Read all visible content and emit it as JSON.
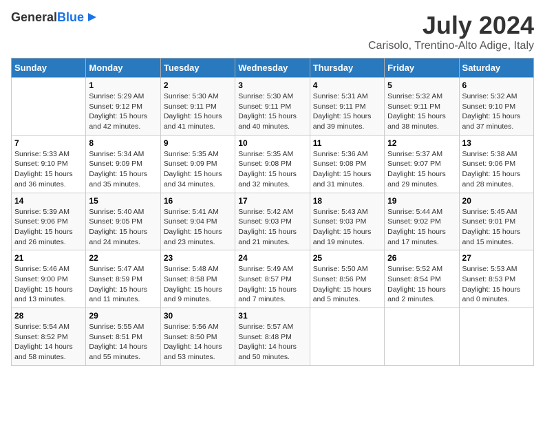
{
  "logo": {
    "line1": "General",
    "line2": "Blue"
  },
  "title": "July 2024",
  "location": "Carisolo, Trentino-Alto Adige, Italy",
  "days_of_week": [
    "Sunday",
    "Monday",
    "Tuesday",
    "Wednesday",
    "Thursday",
    "Friday",
    "Saturday"
  ],
  "weeks": [
    [
      {
        "day": "",
        "info": ""
      },
      {
        "day": "1",
        "info": "Sunrise: 5:29 AM\nSunset: 9:12 PM\nDaylight: 15 hours\nand 42 minutes."
      },
      {
        "day": "2",
        "info": "Sunrise: 5:30 AM\nSunset: 9:11 PM\nDaylight: 15 hours\nand 41 minutes."
      },
      {
        "day": "3",
        "info": "Sunrise: 5:30 AM\nSunset: 9:11 PM\nDaylight: 15 hours\nand 40 minutes."
      },
      {
        "day": "4",
        "info": "Sunrise: 5:31 AM\nSunset: 9:11 PM\nDaylight: 15 hours\nand 39 minutes."
      },
      {
        "day": "5",
        "info": "Sunrise: 5:32 AM\nSunset: 9:11 PM\nDaylight: 15 hours\nand 38 minutes."
      },
      {
        "day": "6",
        "info": "Sunrise: 5:32 AM\nSunset: 9:10 PM\nDaylight: 15 hours\nand 37 minutes."
      }
    ],
    [
      {
        "day": "7",
        "info": "Sunrise: 5:33 AM\nSunset: 9:10 PM\nDaylight: 15 hours\nand 36 minutes."
      },
      {
        "day": "8",
        "info": "Sunrise: 5:34 AM\nSunset: 9:09 PM\nDaylight: 15 hours\nand 35 minutes."
      },
      {
        "day": "9",
        "info": "Sunrise: 5:35 AM\nSunset: 9:09 PM\nDaylight: 15 hours\nand 34 minutes."
      },
      {
        "day": "10",
        "info": "Sunrise: 5:35 AM\nSunset: 9:08 PM\nDaylight: 15 hours\nand 32 minutes."
      },
      {
        "day": "11",
        "info": "Sunrise: 5:36 AM\nSunset: 9:08 PM\nDaylight: 15 hours\nand 31 minutes."
      },
      {
        "day": "12",
        "info": "Sunrise: 5:37 AM\nSunset: 9:07 PM\nDaylight: 15 hours\nand 29 minutes."
      },
      {
        "day": "13",
        "info": "Sunrise: 5:38 AM\nSunset: 9:06 PM\nDaylight: 15 hours\nand 28 minutes."
      }
    ],
    [
      {
        "day": "14",
        "info": "Sunrise: 5:39 AM\nSunset: 9:06 PM\nDaylight: 15 hours\nand 26 minutes."
      },
      {
        "day": "15",
        "info": "Sunrise: 5:40 AM\nSunset: 9:05 PM\nDaylight: 15 hours\nand 24 minutes."
      },
      {
        "day": "16",
        "info": "Sunrise: 5:41 AM\nSunset: 9:04 PM\nDaylight: 15 hours\nand 23 minutes."
      },
      {
        "day": "17",
        "info": "Sunrise: 5:42 AM\nSunset: 9:03 PM\nDaylight: 15 hours\nand 21 minutes."
      },
      {
        "day": "18",
        "info": "Sunrise: 5:43 AM\nSunset: 9:03 PM\nDaylight: 15 hours\nand 19 minutes."
      },
      {
        "day": "19",
        "info": "Sunrise: 5:44 AM\nSunset: 9:02 PM\nDaylight: 15 hours\nand 17 minutes."
      },
      {
        "day": "20",
        "info": "Sunrise: 5:45 AM\nSunset: 9:01 PM\nDaylight: 15 hours\nand 15 minutes."
      }
    ],
    [
      {
        "day": "21",
        "info": "Sunrise: 5:46 AM\nSunset: 9:00 PM\nDaylight: 15 hours\nand 13 minutes."
      },
      {
        "day": "22",
        "info": "Sunrise: 5:47 AM\nSunset: 8:59 PM\nDaylight: 15 hours\nand 11 minutes."
      },
      {
        "day": "23",
        "info": "Sunrise: 5:48 AM\nSunset: 8:58 PM\nDaylight: 15 hours\nand 9 minutes."
      },
      {
        "day": "24",
        "info": "Sunrise: 5:49 AM\nSunset: 8:57 PM\nDaylight: 15 hours\nand 7 minutes."
      },
      {
        "day": "25",
        "info": "Sunrise: 5:50 AM\nSunset: 8:56 PM\nDaylight: 15 hours\nand 5 minutes."
      },
      {
        "day": "26",
        "info": "Sunrise: 5:52 AM\nSunset: 8:54 PM\nDaylight: 15 hours\nand 2 minutes."
      },
      {
        "day": "27",
        "info": "Sunrise: 5:53 AM\nSunset: 8:53 PM\nDaylight: 15 hours\nand 0 minutes."
      }
    ],
    [
      {
        "day": "28",
        "info": "Sunrise: 5:54 AM\nSunset: 8:52 PM\nDaylight: 14 hours\nand 58 minutes."
      },
      {
        "day": "29",
        "info": "Sunrise: 5:55 AM\nSunset: 8:51 PM\nDaylight: 14 hours\nand 55 minutes."
      },
      {
        "day": "30",
        "info": "Sunrise: 5:56 AM\nSunset: 8:50 PM\nDaylight: 14 hours\nand 53 minutes."
      },
      {
        "day": "31",
        "info": "Sunrise: 5:57 AM\nSunset: 8:48 PM\nDaylight: 14 hours\nand 50 minutes."
      },
      {
        "day": "",
        "info": ""
      },
      {
        "day": "",
        "info": ""
      },
      {
        "day": "",
        "info": ""
      }
    ]
  ]
}
